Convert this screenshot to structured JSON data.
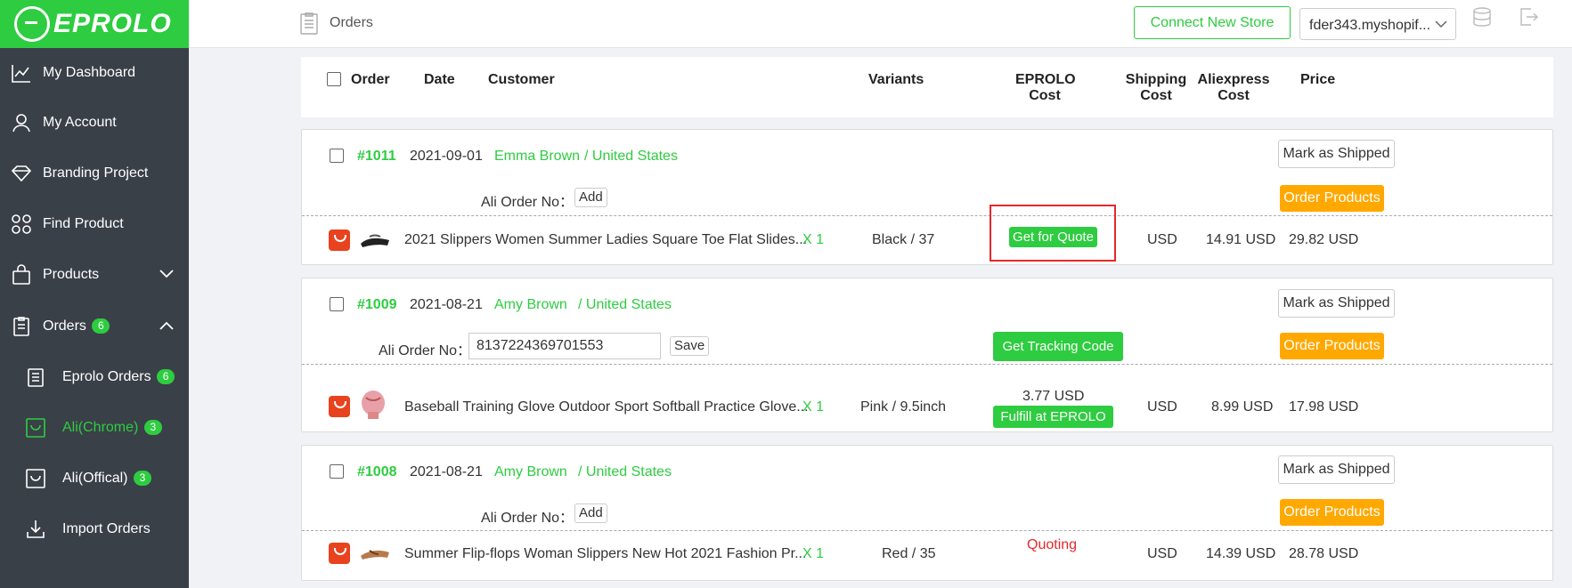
{
  "app": {
    "logo_text": "EPROLO"
  },
  "sidebar": {
    "items": [
      {
        "label": "My Dashboard",
        "icon": "chart-line-icon"
      },
      {
        "label": "My Account",
        "icon": "user-icon"
      },
      {
        "label": "Branding Project",
        "icon": "diamond-icon"
      },
      {
        "label": "Find Product",
        "icon": "grid-icon"
      },
      {
        "label": "Products",
        "icon": "bag-icon"
      },
      {
        "label": "Orders",
        "icon": "clipboard-icon",
        "badge": "6"
      }
    ],
    "sub_items": [
      {
        "label": "Eprolo Orders",
        "badge": "6",
        "icon": "document-icon"
      },
      {
        "label": "Ali(Chrome)",
        "badge": "3",
        "icon": "ali-bag-icon"
      },
      {
        "label": "Ali(Offical)",
        "badge": "3",
        "icon": "ali-bag-icon"
      },
      {
        "label": "Import Orders",
        "icon": "download-icon"
      }
    ]
  },
  "topbar": {
    "title": "Orders",
    "connect_label": "Connect New Store",
    "store_value": "fder343.myshopif..."
  },
  "table_header": {
    "order": "Order",
    "date": "Date",
    "customer": "Customer",
    "variants": "Variants",
    "eprolo_cost_1": "EPROLO",
    "eprolo_cost_2": "Cost",
    "shipping_cost_1": "Shipping",
    "shipping_cost_2": "Cost",
    "aliexpress_cost_1": "Aliexpress",
    "aliexpress_cost_2": "Cost",
    "price": "Price"
  },
  "orders": [
    {
      "number": "#1011",
      "date": "2021-09-01",
      "customer": "Emma Brown",
      "country": "/ United States",
      "ali_label": "Ali Order No：",
      "ali_action": "Add",
      "mark_label": "Mark as Shipped",
      "order_products_label": "Order Products",
      "product": "2021 Slippers Women Summer Ladies Square Toe Flat Slides...",
      "qty": "X 1",
      "variant": "Black / 37",
      "eprolo_action": "Get for Quote",
      "shipping": "USD",
      "ali_cost": "14.91 USD",
      "price": "29.82 USD"
    },
    {
      "number": "#1009",
      "date": "2021-08-21",
      "customer": "Amy Brown",
      "country": "/ United States",
      "ali_label": "Ali Order No：",
      "ali_value": "8137224369701553",
      "ali_action": "Save",
      "tracking_label": "Get Tracking Code",
      "mark_label": "Mark as Shipped",
      "order_products_label": "Order Products",
      "product": "Baseball Training Glove Outdoor Sport Softball Practice Glove...",
      "qty": "X 1",
      "variant": "Pink / 9.5inch",
      "eprolo_cost": "3.77 USD",
      "eprolo_action": "Fulfill at EPROLO",
      "shipping": "USD",
      "ali_cost": "8.99 USD",
      "price": "17.98 USD"
    },
    {
      "number": "#1008",
      "date": "2021-08-21",
      "customer": "Amy Brown",
      "country": "/ United States",
      "ali_label": "Ali Order No：",
      "ali_action": "Add",
      "mark_label": "Mark as Shipped",
      "order_products_label": "Order Products",
      "product": "Summer Flip-flops Woman Slippers New Hot 2021 Fashion Pr...",
      "qty": "X 1",
      "variant": "Red / 35",
      "eprolo_status": "Quoting",
      "shipping": "USD",
      "ali_cost": "14.39 USD",
      "price": "28.78 USD"
    }
  ],
  "colors": {
    "brand_green": "#2ecc40",
    "sidebar_bg": "#3a4048",
    "orange": "#ffa800",
    "highlight_red": "#e5282a"
  }
}
